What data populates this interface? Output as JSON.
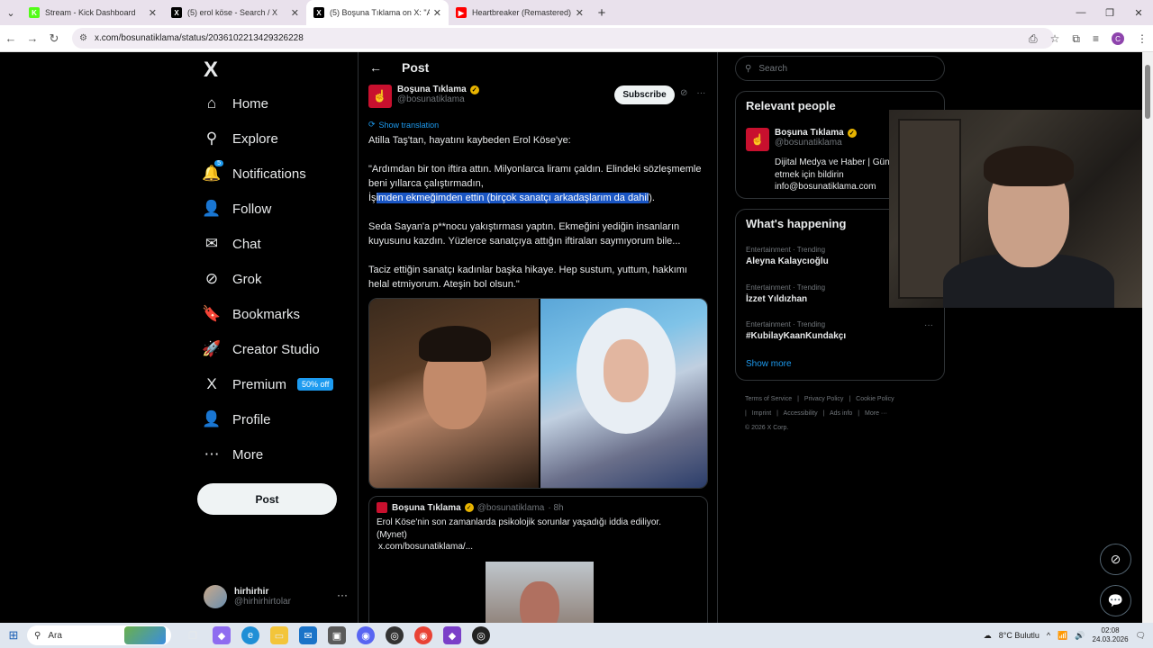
{
  "browser": {
    "tabs": [
      {
        "title": "Stream - Kick Dashboard",
        "color": "#53fc18",
        "glyph": "K",
        "active": false
      },
      {
        "title": "(5) erol köse - Search / X",
        "color": "#000000",
        "glyph": "X",
        "active": false
      },
      {
        "title": "(5) Boşuna Tıklama on X: \"Atilla",
        "color": "#000000",
        "glyph": "X",
        "active": true
      },
      {
        "title": "Heartbreaker (Remastered) - Yo",
        "color": "#ff0000",
        "glyph": "▶",
        "active": false
      }
    ],
    "url": "x.com/bosunatiklama/status/2036102213429326228",
    "profile_initial": "C"
  },
  "nav": {
    "logo": "X",
    "items": [
      {
        "label": "Home",
        "icon": "⌂",
        "name": "home"
      },
      {
        "label": "Explore",
        "icon": "⚲",
        "name": "explore"
      },
      {
        "label": "Notifications",
        "icon": "🔔",
        "name": "notifications",
        "badge": "5"
      },
      {
        "label": "Follow",
        "icon": "👤",
        "name": "follow"
      },
      {
        "label": "Chat",
        "icon": "✉",
        "name": "chat"
      },
      {
        "label": "Grok",
        "icon": "⊘",
        "name": "grok"
      },
      {
        "label": "Bookmarks",
        "icon": "🔖",
        "name": "bookmarks"
      },
      {
        "label": "Creator Studio",
        "icon": "🚀",
        "name": "creator-studio"
      },
      {
        "label": "Premium",
        "icon": "X",
        "name": "premium",
        "promo": "50% off"
      },
      {
        "label": "Profile",
        "icon": "👤",
        "name": "profile"
      },
      {
        "label": "More",
        "icon": "⋯",
        "name": "more"
      }
    ],
    "post_button": "Post",
    "user": {
      "name": "hirhirhir",
      "handle": "@hirhirhirtolar"
    }
  },
  "post": {
    "header_title": "Post",
    "author_name": "Boşuna Tıklama",
    "author_handle": "@bosunatiklama",
    "subscribe": "Subscribe",
    "show_translation": "Show translation",
    "para1": "Atilla Taş'tan, hayatını kaybeden Erol Köse'ye:",
    "para2_a": "\"Ardımdan bir ton iftira attın. Milyonlarca liramı çaldın. Elindeki sözleşmemle beni yıllarca çalıştırmadın,",
    "para2_b_pre": "İş",
    "para2_b_hl": "imden ekmeğimden ettin (birçok sanatçı arkadaşlarım da dahil",
    "para2_b_post": ").",
    "para3": "Seda Sayan'a p**nocu yakıştırması yaptın. Ekmeğini yediğin insanların kuyusunu kazdın. Yüzlerce sanatçıya attığın iftiraları saymıyorum bile...",
    "para4": "Taciz ettiğin sanatçı kadınlar başka hikaye. Hep sustum, yuttum, hakkımı helal etmiyorum. Ateşin bol olsun.\"",
    "quote": {
      "name": "Boşuna Tıklama",
      "handle": "@bosunatiklama",
      "time": "· 8h",
      "text1": "Erol Köse'nin son zamanlarda psikolojik sorunlar yaşadığı iddia ediliyor.",
      "text2": "(Mynet)",
      "text3": "x.com/bosunatiklama/..."
    }
  },
  "right": {
    "search_placeholder": "Search",
    "relevant_title": "Relevant people",
    "person_name": "Boşuna Tıklama",
    "person_handle": "@bosunatiklama",
    "person_bio": "Dijital Medya ve Haber | Gün tıkla takip etmek için bildirin info@bosunatiklama.com",
    "happening_title": "What's happening",
    "trends": [
      {
        "category": "Entertainment · Trending",
        "name": "Aleyna Kalaycıoğlu"
      },
      {
        "category": "Entertainment · Trending",
        "name": "İzzet Yıldızhan"
      },
      {
        "category": "Entertainment · Trending",
        "name": "#KubilayKaanKundakçı"
      }
    ],
    "show_more": "Show more",
    "footer": [
      "Terms of Service",
      "|",
      "Privacy Policy",
      "|",
      "Cookie Policy",
      "|",
      "Imprint",
      "|",
      "Accessibility",
      "|",
      "Ads info",
      "|",
      "More ···",
      "© 2026 X Corp."
    ]
  },
  "taskbar": {
    "search_label": "Ara",
    "weather": "8°C  Bulutlu",
    "time": "02:08",
    "date": "24.03.2026"
  }
}
